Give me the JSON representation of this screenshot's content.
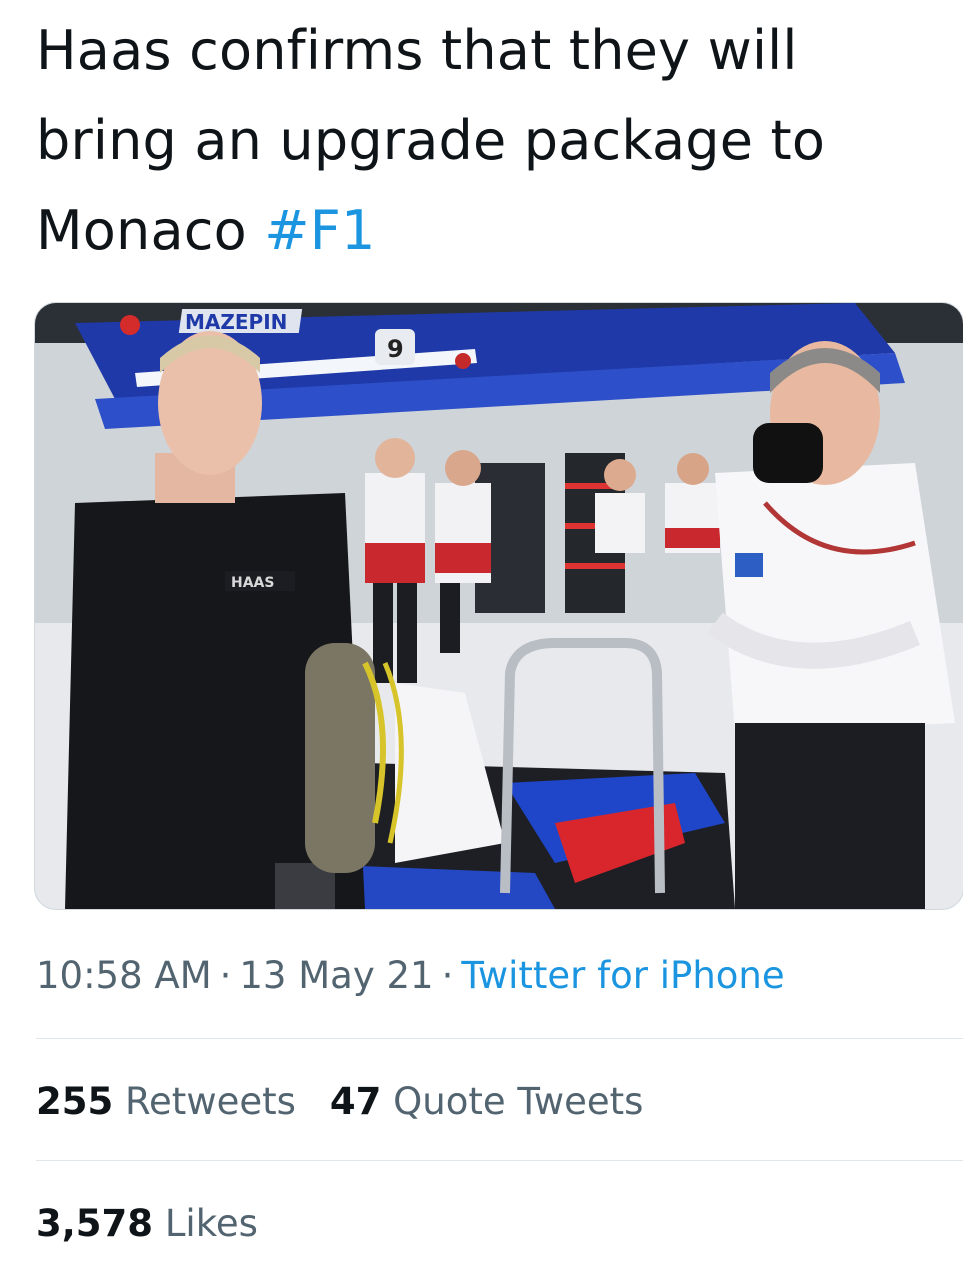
{
  "tweet": {
    "text_main": "Haas confirms that they will bring an upgrade package to Monaco ",
    "hashtag": "#F1"
  },
  "media": {
    "icon": "photo",
    "overlay_text": {
      "banner_name": "MAZEPIN",
      "car_number": "9",
      "shirt_logo": "HAAS"
    }
  },
  "meta": {
    "time": "10:58 AM",
    "separator": "·",
    "date": "13 May 21",
    "source": "Twitter for iPhone"
  },
  "stats": {
    "retweets_count": "255",
    "retweets_label": "Retweets",
    "quotes_count": "47",
    "quotes_label": "Quote Tweets",
    "likes_count": "3,578",
    "likes_label": "Likes"
  },
  "colors": {
    "link": "#1b95e0",
    "text": "#0f1419",
    "secondary": "#536471",
    "divider": "#e1e6ea"
  }
}
